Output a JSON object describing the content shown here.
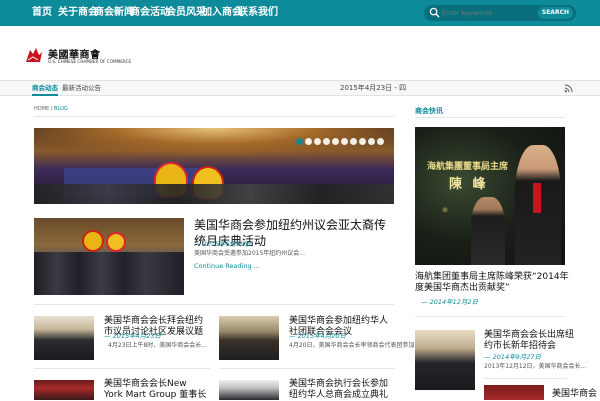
{
  "topnav": {
    "items": [
      "首页",
      "关于商会",
      "商会新闻",
      "商会活动",
      "会员风采",
      "加入商会",
      "联系我们"
    ],
    "search_placeholder": "Enter keywords",
    "search_button": "SEARCH"
  },
  "brand": {
    "title": "美國華商會",
    "subtitle": "U.S. CHINESE CHAMBER OF COMMERCE"
  },
  "tabs": [
    "商会动态",
    "最新活动公告"
  ],
  "date": "2015年4月23日 - 四",
  "breadcrumb": {
    "home": "HOME",
    "sep": "/",
    "current": "BLOG"
  },
  "slider": {
    "total": 10,
    "active": 0
  },
  "featured": {
    "title": "美国华商会参加纽约州议会亚太裔传统月庆典活动",
    "date": "— 2015年5月29日",
    "excerpt": "美国华商会受邀参加2015年纽约州议会...",
    "more": "Continue Reading ..."
  },
  "posts": [
    {
      "title": "美国华商会会长拜会纽约市议员讨论社区发展议题",
      "date": "— 2015年4月23日",
      "excerpt": "4月23日上午8时，美国华商会会长..."
    },
    {
      "title": "美国华商会参加纽约华人社团联合会会议",
      "date": "— 2015年4月20日",
      "excerpt": "4月20日，美国华商会会长率领商会代表团参加..."
    },
    {
      "title": "美国华商会会长New York Mart Group 董事长",
      "date": "",
      "excerpt": ""
    },
    {
      "title": "美国华商会执行会长参加纽约华人总商会成立典礼",
      "date": "",
      "excerpt": ""
    }
  ],
  "sidebar": {
    "heading": "商会快讯",
    "feature": {
      "screen_text_1": "海航集團董事局主席",
      "screen_text_2": "陳 峰",
      "title": "海航集团董事局主席陈峰荣获“2014年度美国华商杰出贡献奖”",
      "date": "— 2014年12月2日"
    },
    "post": {
      "title": "美国华商会会长出席纽约市长新年招待会",
      "date": "— 2014年9月27日",
      "excerpt": "2013年12月12日，美国华商会会长..."
    },
    "post2_title": "美国华商会"
  },
  "colors": {
    "accent": "#0d8b9b",
    "accent_dark": "#0a6f7c"
  }
}
